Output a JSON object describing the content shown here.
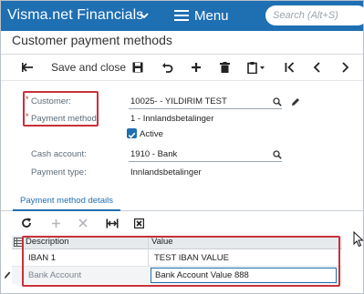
{
  "header": {
    "brand": "Visma.net Financials",
    "menu_label": "Menu",
    "search_placeholder": "Search (Alt+S)"
  },
  "page": {
    "title": "Customer payment methods"
  },
  "toolbar": {
    "save_close_label": "Save and close"
  },
  "form": {
    "customer_label": "Customer:",
    "customer_value": "10025- - YILDIRIM TEST",
    "payment_method_label": "Payment method:",
    "payment_method_value": "1 - Innlandsbetalinger",
    "active_label": "Active",
    "cash_account_label": "Cash account:",
    "cash_account_value": "1910 - Bank",
    "payment_type_label": "Payment type:",
    "payment_type_value": "Innlandsbetalinger"
  },
  "tabs": {
    "active": "Payment method details"
  },
  "grid": {
    "col_description": "Description",
    "col_value": "Value",
    "rows": [
      {
        "description": "IBAN 1",
        "value": "TEST IBAN VALUE"
      },
      {
        "description": "Bank Account",
        "value": "Bank Account Value 888"
      }
    ]
  },
  "colors": {
    "accent": "#1f6fb3",
    "highlight": "#c8313a"
  }
}
